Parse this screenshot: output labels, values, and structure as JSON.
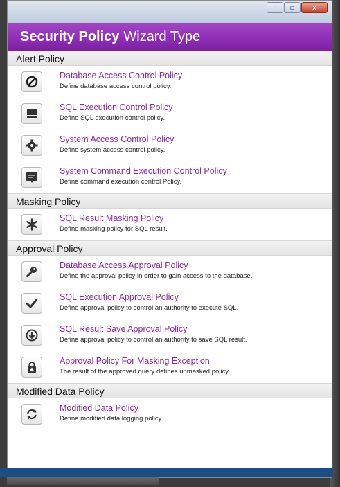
{
  "window": {
    "controls": {
      "minimize": "–",
      "maximize": "▫",
      "close": "x"
    }
  },
  "header": {
    "bold": "Security Policy",
    "rest": "Wizard Type"
  },
  "sections": {
    "alert": "Alert Policy",
    "masking": "Masking Policy",
    "approval": "Approval Policy",
    "modified": "Modified Data Policy"
  },
  "items": [
    {
      "title": "Database Access Control Policy",
      "desc": "Define database access control policy.",
      "icon": "no-entry-icon"
    },
    {
      "title": "SQL Execution Control Policy",
      "desc": "Define SQL execution control policy.",
      "icon": "database-stack-icon"
    },
    {
      "title": "System Access Control Policy",
      "desc": "Define system access control policy.",
      "icon": "gear-icon"
    },
    {
      "title": "System Command Execution Control Policy",
      "desc": "Define command execution control Policy.",
      "icon": "terminal-icon"
    },
    {
      "title": "SQL Result Masking Policy",
      "desc": "Define masking policy for SQL result.",
      "icon": "asterisk-icon"
    },
    {
      "title": "Database Access Approval Policy",
      "desc": "Define the approval policy in order to gain access to the database.",
      "icon": "key-icon"
    },
    {
      "title": "SQL Execution Approval Policy",
      "desc": "Define approval policy to control an authority to execute SQL.",
      "icon": "checkmark-icon"
    },
    {
      "title": "SQL Result Save Approval Policy",
      "desc": "Define approval policy to control an authority to save SQL result.",
      "icon": "download-circle-icon"
    },
    {
      "title": "Approval Policy For Masking Exception",
      "desc": "The result of the approved query defines unmasked policy.",
      "icon": "lock-asterisk-icon"
    },
    {
      "title": "Modified Data Policy",
      "desc": "Define modified data logging policy.",
      "icon": "refresh-icon"
    }
  ]
}
